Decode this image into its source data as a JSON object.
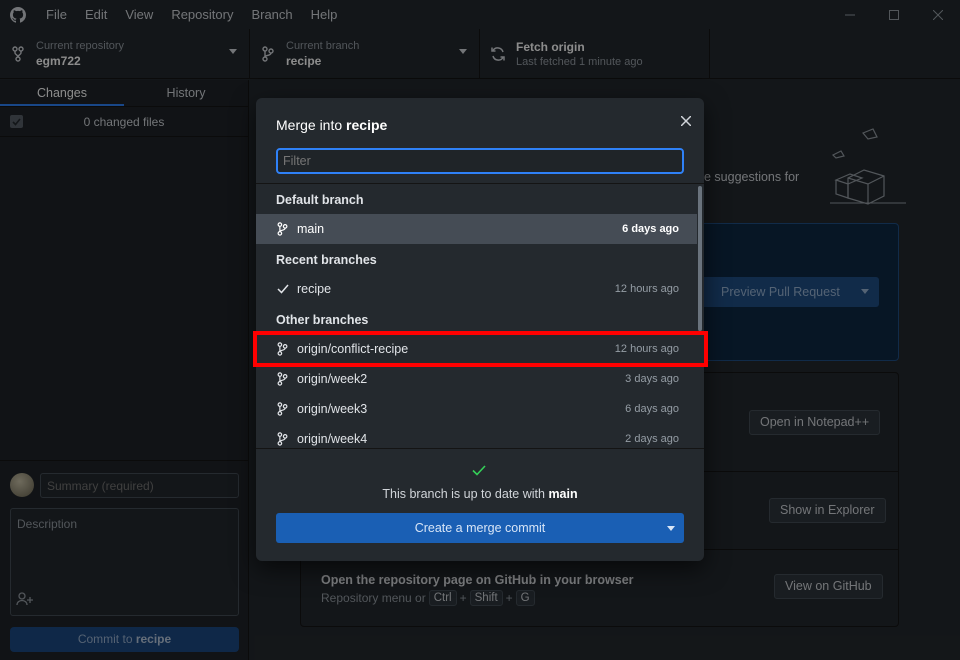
{
  "menu": [
    "File",
    "Edit",
    "View",
    "Repository",
    "Branch",
    "Help"
  ],
  "toolbar": {
    "repo_label": "Current repository",
    "repo_value": "egm722",
    "branch_label": "Current branch",
    "branch_value": "recipe",
    "fetch_label": "Fetch origin",
    "fetch_sub": "Last fetched 1 minute ago"
  },
  "sidebar": {
    "tabs": [
      "Changes",
      "History"
    ],
    "changed_files": "0 changed files",
    "summary_placeholder": "Summary (required)",
    "description_placeholder": "Description",
    "commit_prefix": "Commit to ",
    "commit_branch": "recipe"
  },
  "main": {
    "suggestions_fragment": "e suggestions for",
    "preview_button": "Preview Pull Request",
    "open_editor_button": "Open in Notepad++",
    "show_explorer_button": "Show in Explorer",
    "view_github_button": "View on GitHub",
    "github_row_title": "Open the repository page on GitHub in your browser",
    "github_row_sub": "Repository menu or",
    "keys": [
      "Ctrl",
      "Shift",
      "G"
    ]
  },
  "modal": {
    "title_prefix": "Merge into ",
    "title_branch": "recipe",
    "filter_placeholder": "Filter",
    "groups": {
      "default": "Default branch",
      "recent": "Recent branches",
      "other": "Other branches"
    },
    "branches": {
      "main": {
        "name": "main",
        "time": "6 days ago"
      },
      "recipe": {
        "name": "recipe",
        "time": "12 hours ago"
      },
      "conflict": {
        "name": "origin/conflict-recipe",
        "time": "12 hours ago"
      },
      "week2": {
        "name": "origin/week2",
        "time": "3 days ago"
      },
      "week3": {
        "name": "origin/week3",
        "time": "6 days ago"
      },
      "week4": {
        "name": "origin/week4",
        "time": "2 days ago"
      }
    },
    "status_prefix": "This branch is up to date with ",
    "status_branch": "main",
    "merge_button": "Create a merge commit"
  },
  "colors": {
    "accent": "#2f81f7",
    "highlight": "#ff0000",
    "success": "#34d058"
  }
}
